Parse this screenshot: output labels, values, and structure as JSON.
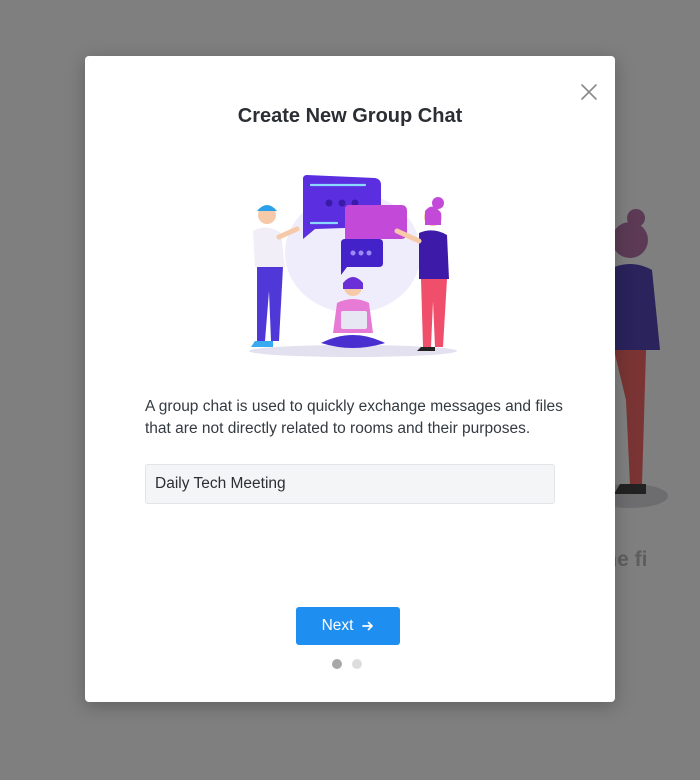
{
  "background": {
    "heading_fragment": "ing the fi"
  },
  "modal": {
    "title": "Create New Group Chat",
    "description": "A group chat is used to quickly exchange messages and files that are not directly related to rooms and their purposes.",
    "name_input_value": "Daily Tech Meeting",
    "next_label": "Next",
    "pagination": {
      "total": 2,
      "current": 1
    },
    "icons": {
      "close": "close-icon",
      "next_arrow": "arrow-right-icon",
      "illustration": "group-chat-illustration"
    }
  },
  "colors": {
    "overlay": "#7f7f7f",
    "primary": "#1e8ff0",
    "title": "#2b2f33",
    "dot_active": "#a8a8a8",
    "dot_inactive": "#dddddd"
  }
}
